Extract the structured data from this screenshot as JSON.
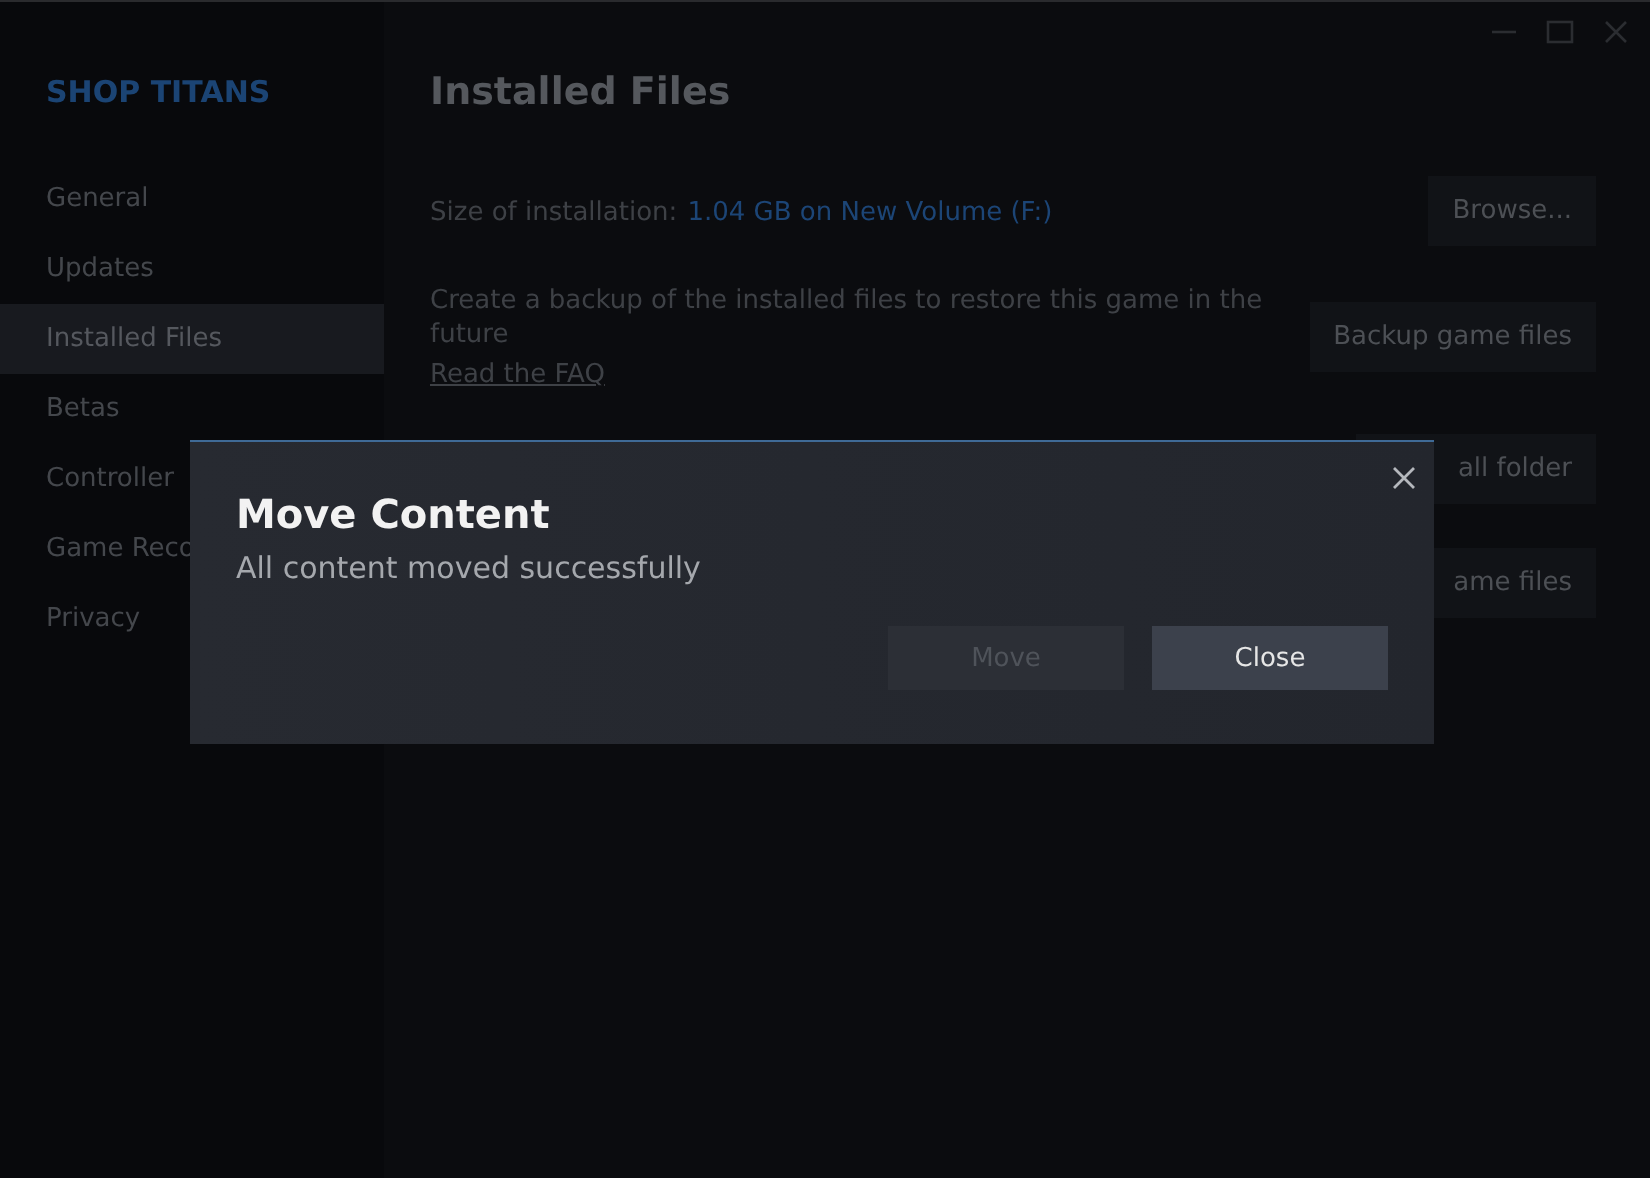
{
  "sidebar": {
    "title": "SHOP TITANS",
    "items": [
      {
        "label": "General",
        "selected": false
      },
      {
        "label": "Updates",
        "selected": false
      },
      {
        "label": "Installed Files",
        "selected": true
      },
      {
        "label": "Betas",
        "selected": false
      },
      {
        "label": "Controller",
        "selected": false
      },
      {
        "label": "Game Reco",
        "selected": false
      },
      {
        "label": "Privacy",
        "selected": false
      }
    ]
  },
  "main": {
    "heading": "Installed Files",
    "size_label": "Size of installation:",
    "size_value": "1.04 GB on New Volume (F:)",
    "browse_button": "Browse...",
    "backup_text": "Create a backup of the installed files to restore this game in the future",
    "faq_link": "Read the FAQ",
    "backup_button": "Backup game files",
    "partial_buttons": [
      "all folder",
      "ame files"
    ]
  },
  "dialog": {
    "title": "Move Content",
    "message": "All content moved successfully",
    "buttons": [
      {
        "label": "Move",
        "disabled": true
      },
      {
        "label": "Close",
        "disabled": false
      }
    ]
  }
}
